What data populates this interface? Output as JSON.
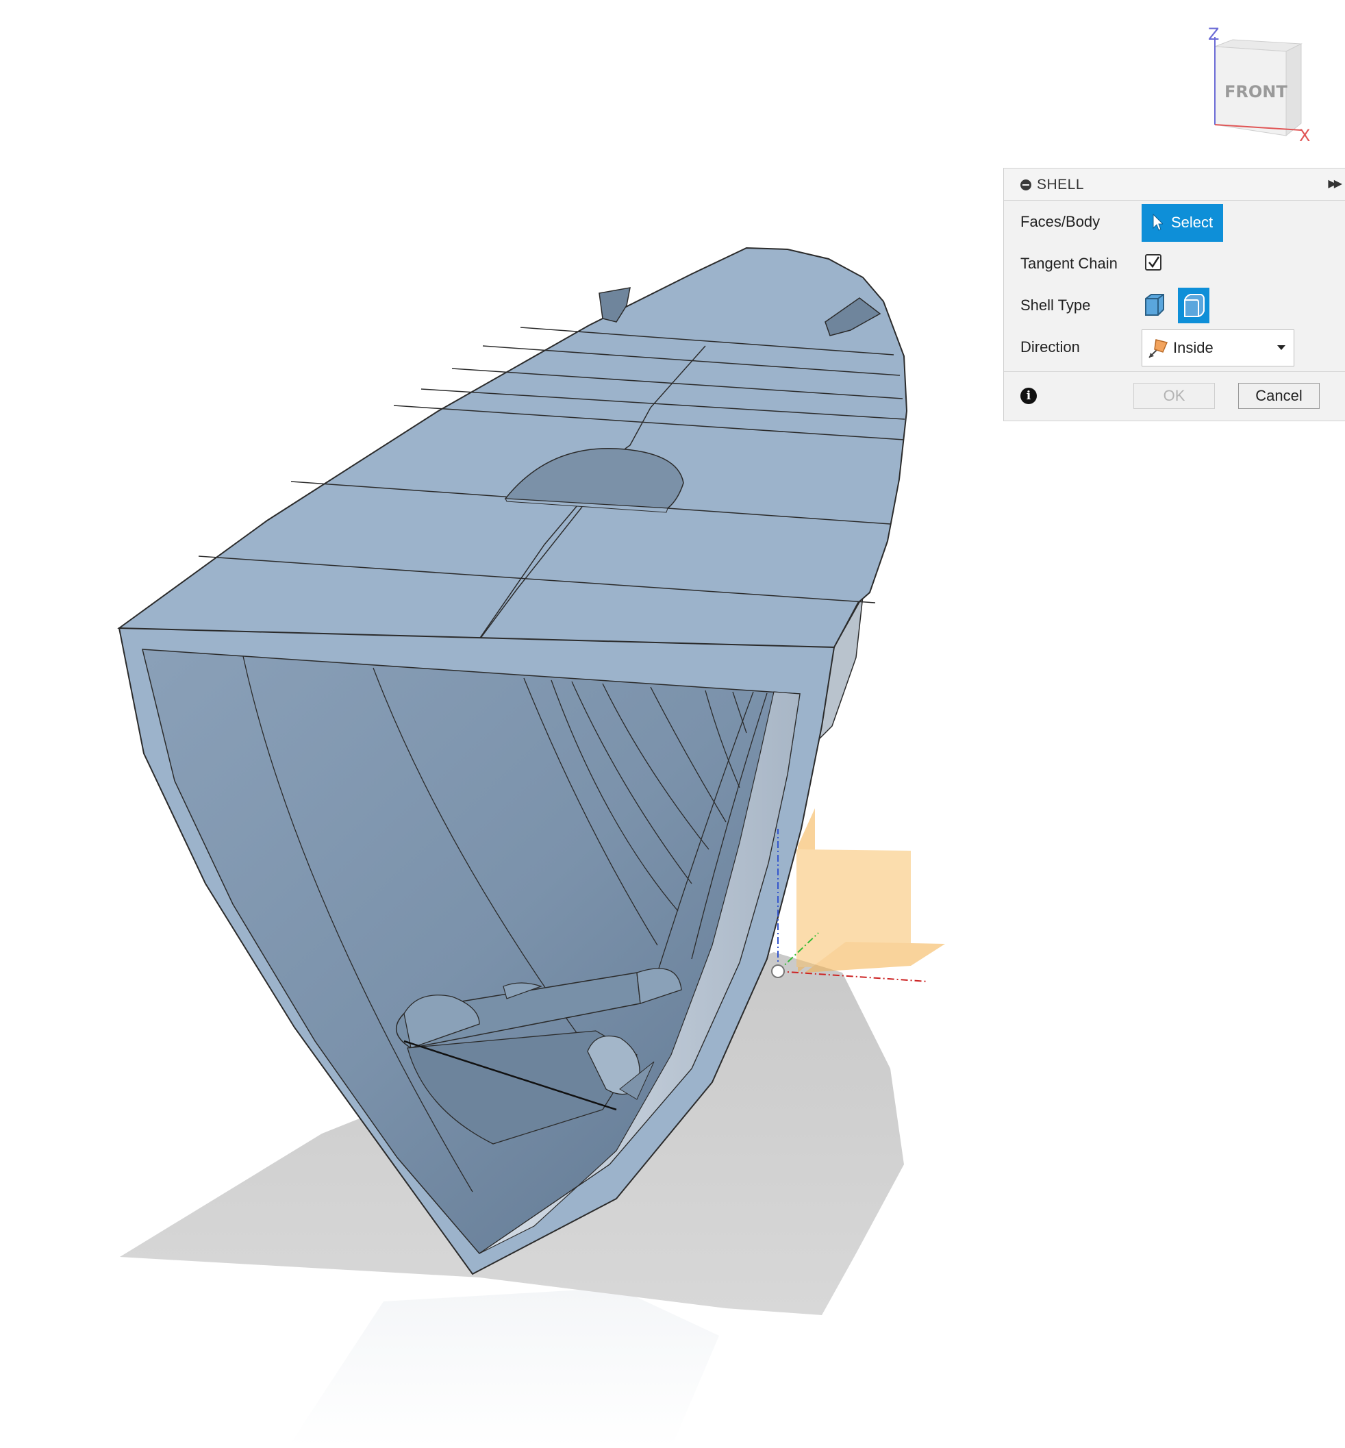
{
  "viewcube": {
    "face_label": "FRONT",
    "axis_z": "Z",
    "axis_x": "X"
  },
  "shell_dialog": {
    "title": "SHELL",
    "faces_body_label": "Faces/Body",
    "select_button": "Select",
    "tangent_chain_label": "Tangent Chain",
    "tangent_chain_checked": true,
    "shell_type_label": "Shell Type",
    "direction_label": "Direction",
    "direction_value": "Inside",
    "ok_label": "OK",
    "cancel_label": "Cancel"
  },
  "colors": {
    "model_face": "#9cb3cb",
    "accent": "#0e8fd8",
    "origin_plane": "#f5b04a"
  }
}
